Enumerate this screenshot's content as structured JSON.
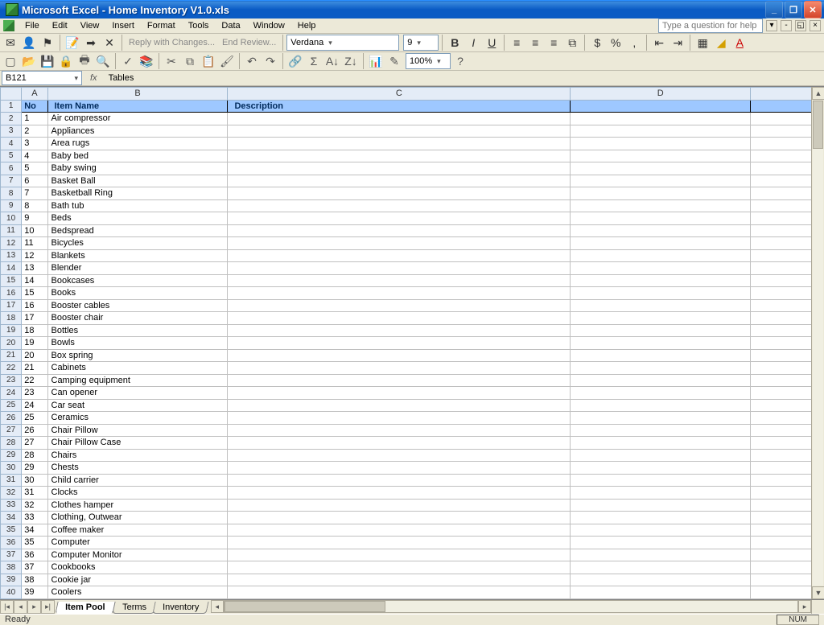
{
  "titlebar": {
    "title": "Microsoft Excel - Home Inventory V1.0.xls"
  },
  "menu": {
    "items": [
      "File",
      "Edit",
      "View",
      "Insert",
      "Format",
      "Tools",
      "Data",
      "Window",
      "Help"
    ],
    "help_placeholder": "Type a question for help"
  },
  "toolbar": {
    "reply": "Reply with Changes...",
    "end_review": "End Review...",
    "font_name": "Verdana",
    "font_size": "9",
    "zoom": "100%"
  },
  "formula": {
    "cell_ref": "B121",
    "fx_label": "fx",
    "value": "Tables"
  },
  "columns": [
    "A",
    "B",
    "C",
    "D"
  ],
  "header_row": {
    "no": "No",
    "item": "Item Name",
    "desc": "Description"
  },
  "items": [
    {
      "no": 1,
      "name": "Air compressor"
    },
    {
      "no": 2,
      "name": "Appliances"
    },
    {
      "no": 3,
      "name": "Area rugs"
    },
    {
      "no": 4,
      "name": "Baby bed"
    },
    {
      "no": 5,
      "name": "Baby swing"
    },
    {
      "no": 6,
      "name": "Basket Ball"
    },
    {
      "no": 7,
      "name": "Basketball Ring"
    },
    {
      "no": 8,
      "name": "Bath tub"
    },
    {
      "no": 9,
      "name": "Beds"
    },
    {
      "no": 10,
      "name": "Bedspread"
    },
    {
      "no": 11,
      "name": "Bicycles"
    },
    {
      "no": 12,
      "name": "Blankets"
    },
    {
      "no": 13,
      "name": "Blender"
    },
    {
      "no": 14,
      "name": "Bookcases"
    },
    {
      "no": 15,
      "name": "Books"
    },
    {
      "no": 16,
      "name": "Booster cables"
    },
    {
      "no": 17,
      "name": "Booster chair"
    },
    {
      "no": 18,
      "name": "Bottles"
    },
    {
      "no": 19,
      "name": "Bowls"
    },
    {
      "no": 20,
      "name": "Box spring"
    },
    {
      "no": 21,
      "name": "Cabinets"
    },
    {
      "no": 22,
      "name": "Camping equipment"
    },
    {
      "no": 23,
      "name": "Can opener"
    },
    {
      "no": 24,
      "name": "Car seat"
    },
    {
      "no": 25,
      "name": "Ceramics"
    },
    {
      "no": 26,
      "name": "Chair Pillow"
    },
    {
      "no": 27,
      "name": "Chair Pillow Case"
    },
    {
      "no": 28,
      "name": "Chairs"
    },
    {
      "no": 29,
      "name": "Chests"
    },
    {
      "no": 30,
      "name": "Child carrier"
    },
    {
      "no": 31,
      "name": "Clocks"
    },
    {
      "no": 32,
      "name": "Clothes hamper"
    },
    {
      "no": 33,
      "name": "Clothing, Outwear"
    },
    {
      "no": 34,
      "name": "Coffee maker"
    },
    {
      "no": 35,
      "name": "Computer"
    },
    {
      "no": 36,
      "name": "Computer Monitor"
    },
    {
      "no": 37,
      "name": "Cookbooks"
    },
    {
      "no": 38,
      "name": "Cookie jar"
    },
    {
      "no": 39,
      "name": "Coolers"
    }
  ],
  "visible_row_count": 40,
  "tabs": {
    "items": [
      "Item Pool",
      "Terms",
      "Inventory"
    ],
    "active_index": 0
  },
  "status": {
    "ready": "Ready",
    "num": "NUM"
  }
}
